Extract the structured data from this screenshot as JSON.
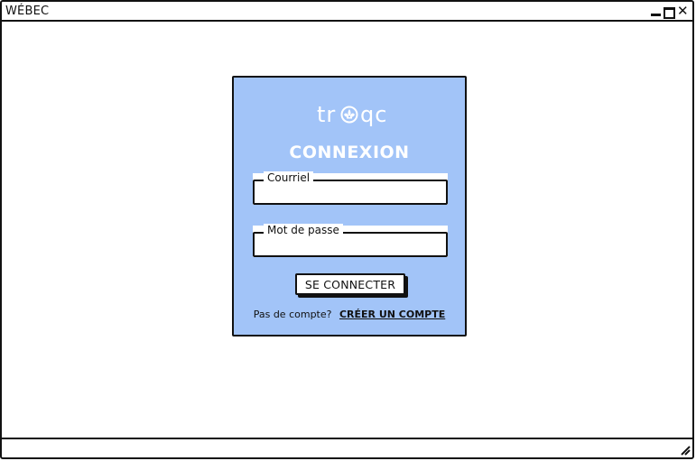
{
  "window": {
    "title": "WÉBEC",
    "controls": {
      "minimize": "minimize-icon",
      "maximize": "maximize-icon",
      "close": "close-icon"
    }
  },
  "login": {
    "logo_text": "troqc",
    "heading": "CONNEXION",
    "email": {
      "label": "Courriel",
      "value": ""
    },
    "password": {
      "label": "Mot de passe",
      "value": ""
    },
    "submit_label": "SE CONNECTER",
    "no_account_text": "Pas de compte?",
    "create_account_label": "CRÉER UN COMPTE"
  },
  "colors": {
    "panel_bg": "#a2c4f8",
    "heading_color": "#ffffff"
  }
}
